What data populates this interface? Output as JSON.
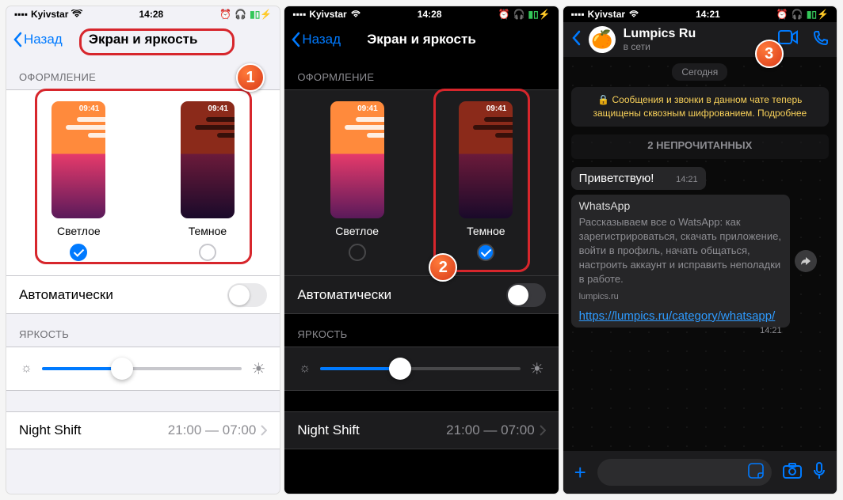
{
  "status": {
    "carrier": "Kyivstar",
    "time": "14:28"
  },
  "status2": {
    "carrier": "Kyivstar",
    "time": "14:21"
  },
  "nav": {
    "back": "Назад",
    "title": "Экран и яркость"
  },
  "appearance": {
    "section": "ОФОРМЛЕНИЕ",
    "light": "Светлое",
    "dark": "Темное",
    "thumb_time": "09:41",
    "auto": "Автоматически"
  },
  "brightness": {
    "section": "ЯРКОСТЬ",
    "value": 40
  },
  "nightshift": {
    "label": "Night Shift",
    "value": "21:00 — 07:00"
  },
  "badges": {
    "one": "1",
    "two": "2",
    "three": "3"
  },
  "whatsapp": {
    "name": "Lumpics Ru",
    "status": "в сети",
    "today": "Сегодня",
    "encryption": "🔒 Сообщения и звонки в данном чате теперь защищены сквозным шифрованием. Подробнее",
    "unread": "2 НЕПРОЧИТАННЫХ",
    "msg1": {
      "text": "Приветствую!",
      "ts": "14:21"
    },
    "msg2": {
      "title": "WhatsApp",
      "preview": "Рассказываем все о WatsApp: как зарегистрироваться, скачать приложение, войти в профиль, начать общаться, настроить аккаунт и исправить неполадки в работе.",
      "site": "lumpics.ru",
      "link": "https://lumpics.ru/category/whatsapp/",
      "ts": "14:21"
    }
  }
}
